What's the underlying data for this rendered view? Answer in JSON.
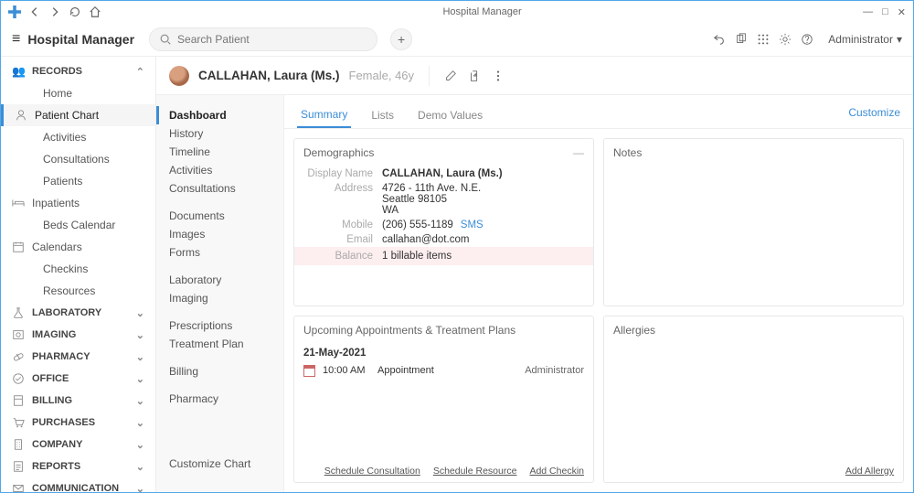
{
  "window": {
    "title": "Hospital Manager"
  },
  "toolbar": {
    "app_name": "Hospital Manager",
    "search_placeholder": "Search Patient",
    "user": "Administrator"
  },
  "sidebar": {
    "records": {
      "label": "RECORDS",
      "items": [
        {
          "label": "Home"
        },
        {
          "label": "Patient Chart",
          "active": true
        },
        {
          "label": "Activities"
        },
        {
          "label": "Consultations"
        },
        {
          "label": "Patients"
        }
      ],
      "inpatients": {
        "label": "Inpatients"
      },
      "beds": {
        "label": "Beds Calendar"
      },
      "calendars": {
        "label": "Calendars"
      },
      "checkins": {
        "label": "Checkins"
      },
      "resources": {
        "label": "Resources"
      }
    },
    "sections": [
      {
        "label": "LABORATORY"
      },
      {
        "label": "IMAGING"
      },
      {
        "label": "PHARMACY"
      },
      {
        "label": "OFFICE"
      },
      {
        "label": "BILLING"
      },
      {
        "label": "PURCHASES"
      },
      {
        "label": "COMPANY"
      },
      {
        "label": "REPORTS"
      },
      {
        "label": "COMMUNICATION"
      }
    ]
  },
  "patient": {
    "name": "CALLAHAN, Laura (Ms.)",
    "gender_age": "Female, 46y"
  },
  "chart_nav": {
    "g1": [
      "Dashboard",
      "History",
      "Timeline",
      "Activities",
      "Consultations"
    ],
    "g2": [
      "Documents",
      "Images",
      "Forms"
    ],
    "g3": [
      "Laboratory",
      "Imaging"
    ],
    "g4": [
      "Prescriptions",
      "Treatment Plan"
    ],
    "g5": [
      "Billing"
    ],
    "g6": [
      "Pharmacy"
    ],
    "customize": "Customize Chart"
  },
  "tabs": [
    "Summary",
    "Lists",
    "Demo Values"
  ],
  "customize_link": "Customize",
  "demographics": {
    "title": "Demographics",
    "labels": {
      "display_name": "Display Name",
      "address": "Address",
      "mobile": "Mobile",
      "email": "Email",
      "balance": "Balance"
    },
    "display_name": "CALLAHAN, Laura (Ms.)",
    "address_line1": "4726 - 11th Ave. N.E.",
    "address_line2": "Seattle 98105",
    "address_line3": "WA",
    "mobile": "(206) 555-1189",
    "sms": "SMS",
    "email": "callahan@dot.com",
    "balance": "1 billable items"
  },
  "notes": {
    "title": "Notes"
  },
  "appointments": {
    "title": "Upcoming Appointments & Treatment Plans",
    "date": "21-May-2021",
    "rows": [
      {
        "time": "10:00 AM",
        "type": "Appointment",
        "by": "Administrator"
      }
    ],
    "links": [
      "Schedule Consultation",
      "Schedule Resource",
      "Add Checkin"
    ]
  },
  "allergies": {
    "title": "Allergies",
    "links": [
      "Add Allergy"
    ]
  }
}
